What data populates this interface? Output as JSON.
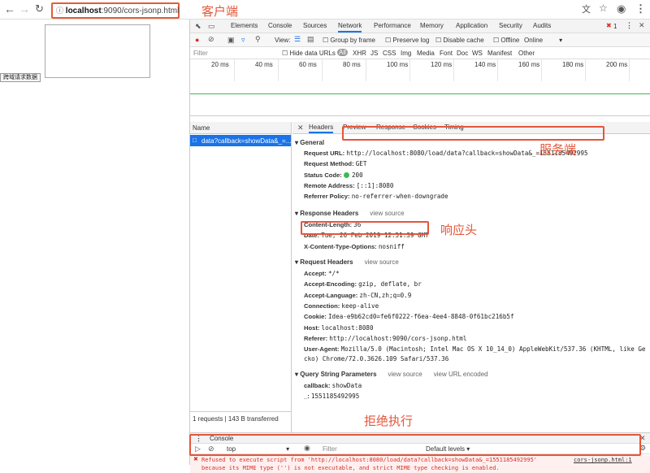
{
  "browser": {
    "url_host": "localhost",
    "url_rest": ":9090/cors-jsonp.html"
  },
  "annotations": {
    "client": "客户端",
    "server": "服务端",
    "resp_header": "响应头",
    "refused": "拒绝执行"
  },
  "page": {
    "button_label": "跨域请求数据"
  },
  "devtools": {
    "tabs": [
      "Elements",
      "Console",
      "Sources",
      "Network",
      "Performance",
      "Memory",
      "Application",
      "Security",
      "Audits"
    ],
    "active_tab": "Network",
    "error_count": "1",
    "toolbar": {
      "view": "View:",
      "group_by_frame": "Group by frame",
      "preserve_log": "Preserve log",
      "disable_cache": "Disable cache",
      "offline": "Offline",
      "online": "Online"
    },
    "filter_bar": {
      "placeholder": "Filter",
      "hide_data_urls": "Hide data URLs",
      "types": [
        "All",
        "XHR",
        "JS",
        "CSS",
        "Img",
        "Media",
        "Font",
        "Doc",
        "WS",
        "Manifest",
        "Other"
      ]
    },
    "timeline_ticks": [
      "20 ms",
      "40 ms",
      "60 ms",
      "80 ms",
      "100 ms",
      "120 ms",
      "140 ms",
      "160 ms",
      "180 ms",
      "200 ms"
    ],
    "name_header": "Name",
    "request_name": "data?callback=showData&_=...",
    "status_bar": "1 requests | 143 B transferred",
    "detail_tabs": [
      "Headers",
      "Preview",
      "Response",
      "Cookies",
      "Timing"
    ],
    "general": {
      "title": "General",
      "rows": [
        {
          "k": "Request URL:",
          "v": "http://localhost:8080/load/data?callback=showData&_=1551185492995"
        },
        {
          "k": "Request Method:",
          "v": "GET"
        },
        {
          "k": "Status Code:",
          "v": "200"
        },
        {
          "k": "Remote Address:",
          "v": "[::1]:8080"
        },
        {
          "k": "Referrer Policy:",
          "v": "no-referrer-when-downgrade"
        }
      ]
    },
    "response_headers": {
      "title": "Response Headers",
      "view_source": "view source",
      "rows": [
        {
          "k": "Content-Length:",
          "v": "36"
        },
        {
          "k": "Date:",
          "v": "Tue, 26 Feb 2019 12:51:39 GMT"
        },
        {
          "k": "X-Content-Type-Options:",
          "v": "nosniff"
        }
      ]
    },
    "request_headers": {
      "title": "Request Headers",
      "view_source": "view source",
      "rows": [
        {
          "k": "Accept:",
          "v": "*/*"
        },
        {
          "k": "Accept-Encoding:",
          "v": "gzip, deflate, br"
        },
        {
          "k": "Accept-Language:",
          "v": "zh-CN,zh;q=0.9"
        },
        {
          "k": "Connection:",
          "v": "keep-alive"
        },
        {
          "k": "Cookie:",
          "v": "Idea-e9b62cd0=fe6f0222-f6ea-4ee4-8848-0f61bc216b5f"
        },
        {
          "k": "Host:",
          "v": "localhost:8080"
        },
        {
          "k": "Referer:",
          "v": "http://localhost:9090/cors-jsonp.html"
        },
        {
          "k": "User-Agent:",
          "v": "Mozilla/5.0 (Macintosh; Intel Mac OS X 10_14_0) AppleWebKit/537.36 (KHTML, like Ge"
        }
      ],
      "ua_cont": "cko) Chrome/72.0.3626.109 Safari/537.36"
    },
    "query": {
      "title": "Query String Parameters",
      "view_source": "view source",
      "view_url_encoded": "view URL encoded",
      "rows": [
        {
          "k": "callback:",
          "v": "showData"
        },
        {
          "k": "_:",
          "v": "1551185492995"
        }
      ]
    },
    "console": {
      "title": "Console",
      "context": "top",
      "filter_placeholder": "Filter",
      "levels": "Default levels",
      "error_line1": "Refused to execute script from 'http://localhost:8080/load/data?callback=showData&_=1551185492995'",
      "error_source": "cors-jsonp.html:1",
      "error_line2": "because its MIME type ('') is not executable, and strict MIME type checking is enabled."
    }
  }
}
